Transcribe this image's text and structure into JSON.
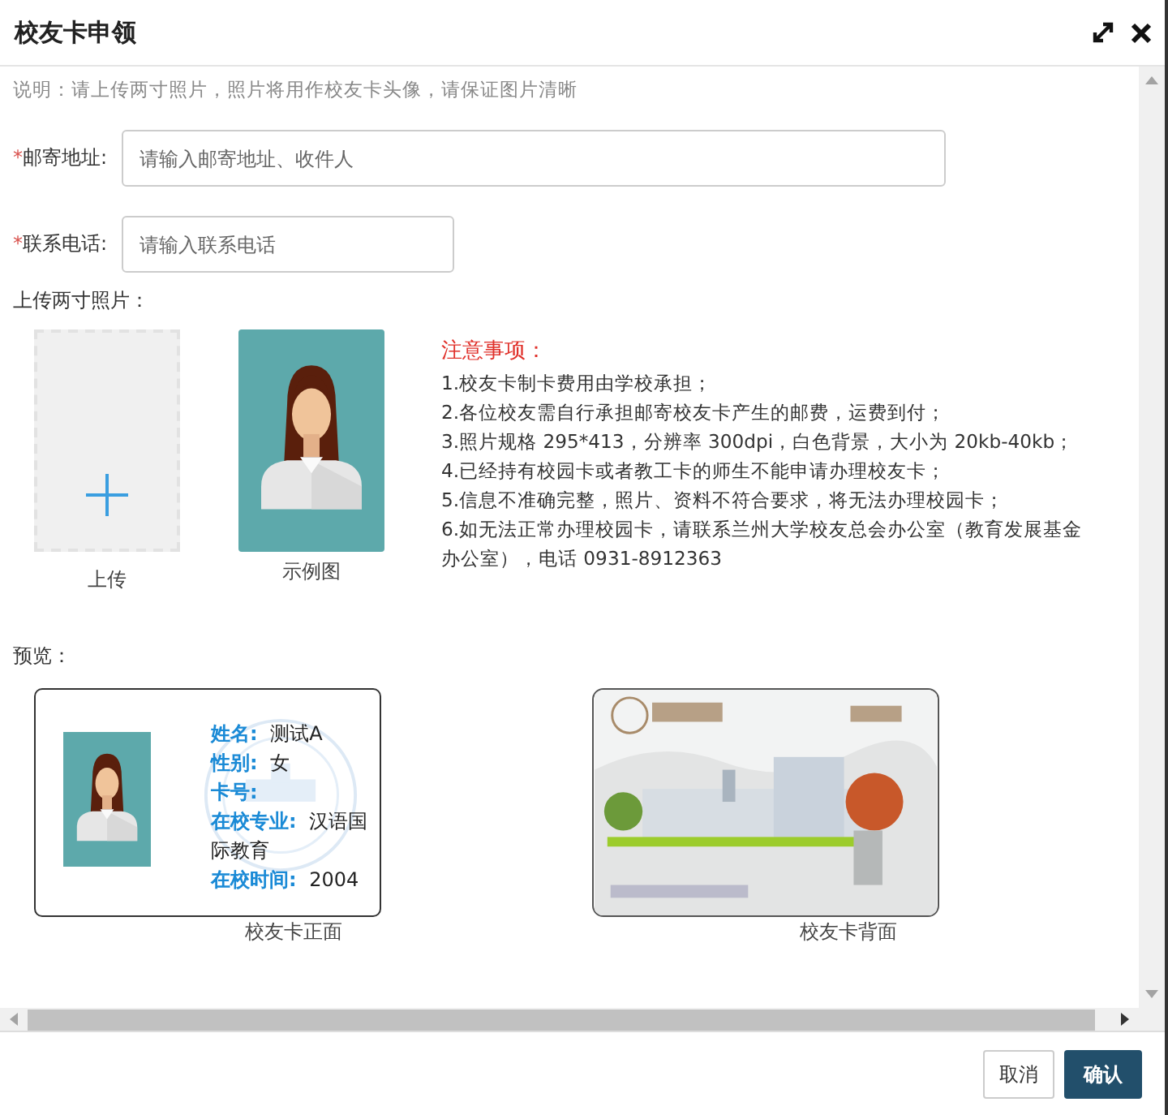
{
  "dialog": {
    "title": "校友卡申领"
  },
  "note": "说明：请上传两寸照片，照片将用作校友卡头像，请保证图片清晰",
  "fields": [
    {
      "label": "邮寄地址:",
      "required_mark": "*",
      "placeholder": "请输入邮寄地址、收件人",
      "kind": "wide"
    },
    {
      "label": "联系电话:",
      "required_mark": "*",
      "placeholder": "请输入联系电话",
      "kind": "narrow"
    }
  ],
  "photo_section": {
    "label": "上传两寸照片：",
    "upload_caption": "上传",
    "sample_caption": "示例图"
  },
  "notice": {
    "title": "注意事项：",
    "items": [
      "1.校友卡制卡费用由学校承担；",
      "2.各位校友需自行承担邮寄校友卡产生的邮费，运费到付；",
      "3.照片规格 295*413，分辨率 300dpi，白色背景，大小为 20kb-40kb；",
      "4.已经持有校园卡或者教工卡的师生不能申请办理校友卡；",
      "5.信息不准确完整，照片、资料不符合要求，将无法办理校园卡；",
      "6.如无法正常办理校园卡，请联系兰州大学校友总会办公室（教育发展基金办公室），电话 0931-8912363"
    ]
  },
  "preview": {
    "label": "预览：",
    "front": {
      "caption": "校友卡正面",
      "fields": [
        {
          "label": "姓名:",
          "value": "测试A"
        },
        {
          "label": "性别:",
          "value": "女"
        },
        {
          "label": "卡号:"
        },
        {
          "label": "在校专业:",
          "value": "汉语国际教育"
        },
        {
          "label": "在校时间:",
          "value": "2004"
        }
      ]
    },
    "back": {
      "caption": "校友卡背面"
    }
  },
  "buttons": [
    {
      "label": "取消",
      "kind": "secondary"
    },
    {
      "label": "确认",
      "kind": "primary"
    }
  ]
}
